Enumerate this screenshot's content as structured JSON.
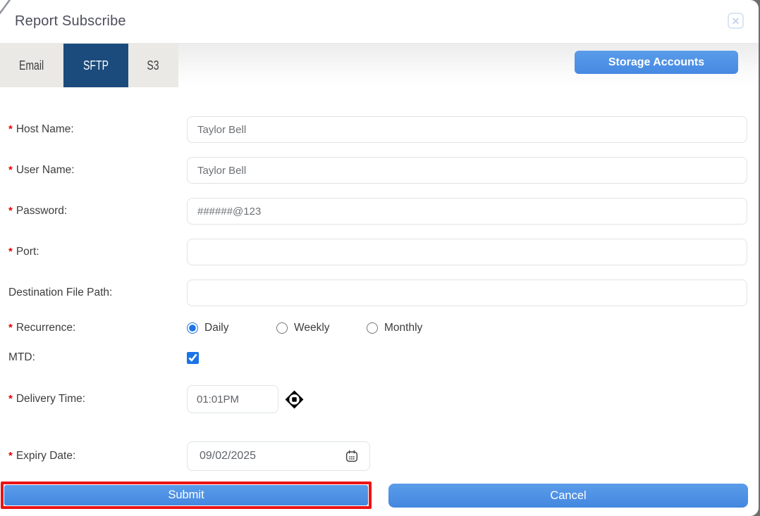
{
  "modal": {
    "title": "Report Subscribe"
  },
  "tabs": [
    {
      "label": "Email"
    },
    {
      "label": "SFTP"
    },
    {
      "label": "S3"
    }
  ],
  "active_tab": "SFTP",
  "storage_accounts_button": "Storage Accounts",
  "form": {
    "required_marker": "*",
    "fields": [
      {
        "label": "Host Name:",
        "required": true,
        "value": "Taylor Bell"
      },
      {
        "label": "User Name:",
        "required": true,
        "value": "Taylor Bell"
      },
      {
        "label": "Password:",
        "required": true,
        "value": "######@123"
      },
      {
        "label": "Port:",
        "required": true,
        "value": ""
      },
      {
        "label": "Destination File Path:",
        "required": false,
        "value": ""
      }
    ],
    "recurrence": {
      "label": "Recurrence:",
      "options": [
        "Daily",
        "Weekly",
        "Monthly"
      ],
      "selected": "Daily"
    },
    "mtd": {
      "label": "MTD:",
      "checked": true
    },
    "delivery_time": {
      "label": "Delivery Time:",
      "value": "01:01PM"
    },
    "expiry_date": {
      "label": "Expiry Date:",
      "value": "09/02/2025"
    }
  },
  "footer": {
    "submit_label": "Submit",
    "cancel_label": "Cancel"
  },
  "colors": {
    "accent_blue": "#4b92e5",
    "active_tab_blue": "#1b4b7d",
    "highlight_red": "#ec1313",
    "required_red": "#e60000"
  }
}
